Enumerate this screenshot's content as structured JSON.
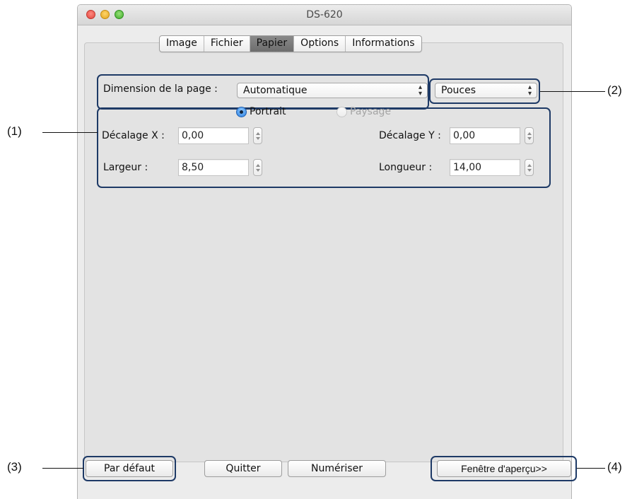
{
  "window": {
    "title": "DS-620"
  },
  "tabs": [
    {
      "label": "Image",
      "active": false
    },
    {
      "label": "Fichier",
      "active": false
    },
    {
      "label": "Papier",
      "active": true
    },
    {
      "label": "Options",
      "active": false
    },
    {
      "label": "Informations",
      "active": false
    }
  ],
  "paper": {
    "page_size_label": "Dimension de la page :",
    "page_size_value": "Automatique",
    "units_value": "Pouces",
    "orientation": {
      "portrait_label": "Portrait",
      "landscape_label": "Paysage",
      "selected": "Portrait"
    },
    "offset_x_label": "Décalage X :",
    "offset_x_value": "0,00",
    "offset_y_label": "Décalage Y :",
    "offset_y_value": "0,00",
    "width_label": "Largeur :",
    "width_value": "8,50",
    "length_label": "Longueur :",
    "length_value": "14,00"
  },
  "buttons": {
    "default_label": "Par défaut",
    "quit_label": "Quitter",
    "scan_label": "Numériser",
    "preview_label": "Fenêtre d'aperçu>>"
  },
  "callouts": {
    "c1": "(1)",
    "c2": "(2)",
    "c3": "(3)",
    "c4": "(4)"
  },
  "colors": {
    "highlight_border": "#1e3a66",
    "radio_selected": "#2a7ee0",
    "active_tab": "#7a7a7a"
  }
}
